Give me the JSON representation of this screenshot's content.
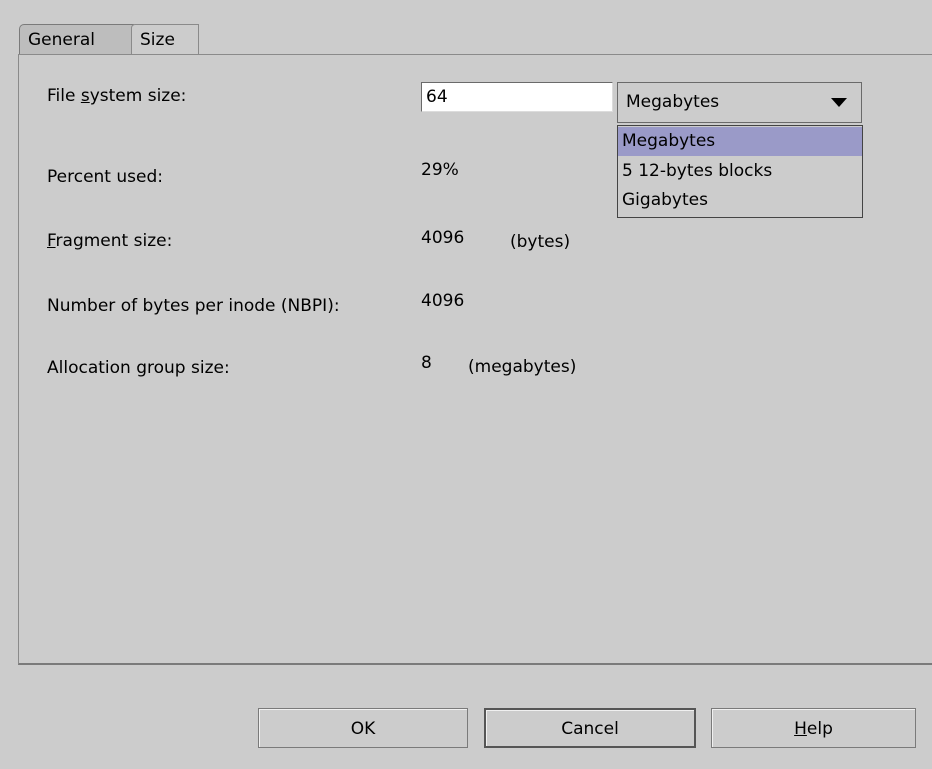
{
  "tabs": {
    "general": "General",
    "size": "Size"
  },
  "fields": {
    "fs_size_label_pre": "File ",
    "fs_size_label_u": "s",
    "fs_size_label_post": "ystem size:",
    "fs_size_value": "64",
    "unit_selected": "Megabytes",
    "percent_used_label": "Percent used:",
    "percent_used_value": "29%",
    "fragment_label_u": "F",
    "fragment_label_post": "ragment size:",
    "fragment_value": "4096",
    "fragment_unit": "(bytes)",
    "nbpi_label": "Number of bytes per inode (NBPI):",
    "nbpi_value": "4096",
    "alloc_label": "Allocation group size:",
    "alloc_value": "8",
    "alloc_unit": "(megabytes)"
  },
  "dropdown": {
    "options": [
      "Megabytes",
      "5 12-bytes blocks",
      "Gigabytes"
    ],
    "selected_index": 0
  },
  "buttons": {
    "ok": "OK",
    "cancel": "Cancel",
    "help_u": "H",
    "help_post": "elp"
  },
  "colors": {
    "background": "#cccccc",
    "selection": "#9a9ac8"
  }
}
